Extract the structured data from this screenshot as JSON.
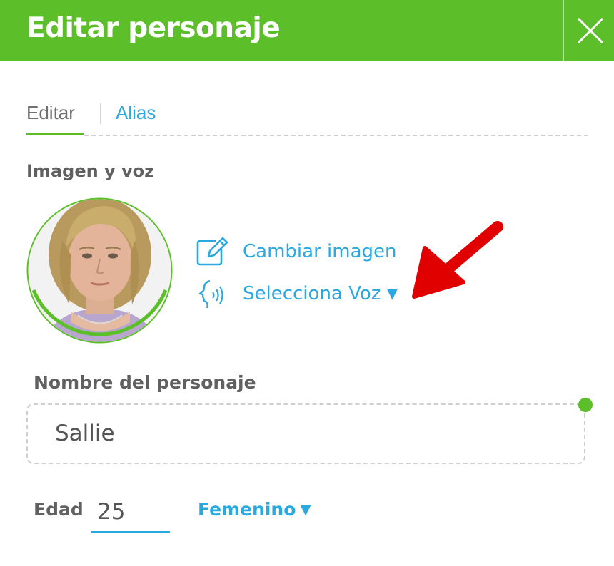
{
  "dialog": {
    "title": "Editar personaje"
  },
  "tabs": [
    {
      "label": "Editar",
      "active": true
    },
    {
      "label": "Alias",
      "active": false
    }
  ],
  "image_voice": {
    "section_title": "Imagen y voz",
    "change_image_label": "Cambiar imagen",
    "change_image_icon": "edit-icon",
    "select_voice_label": "Selecciona Voz",
    "select_voice_icon": "voice-icon",
    "dropdown_caret": "▼"
  },
  "character_name": {
    "label": "Nombre del personaje",
    "value": "Sallie"
  },
  "age": {
    "label": "Edad",
    "value": "25"
  },
  "gender": {
    "value": "Femenino",
    "caret": "▼"
  },
  "colors": {
    "brand_green": "#5cbf2a",
    "link_blue": "#2aa8e0",
    "annotation_red": "#e00000",
    "label_gray": "#606060"
  }
}
